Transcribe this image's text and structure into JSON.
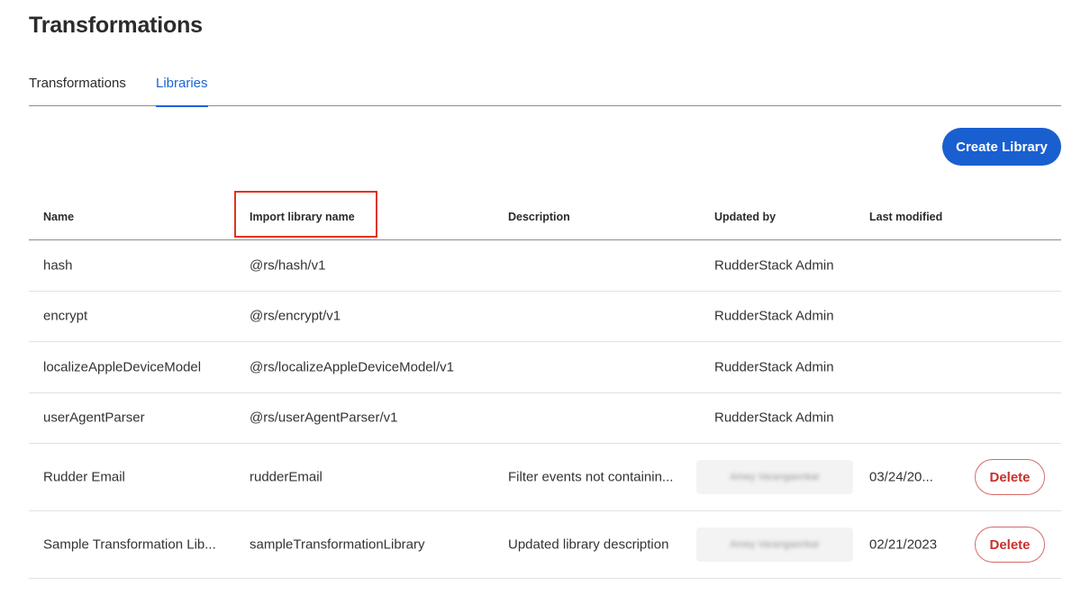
{
  "page": {
    "title": "Transformations"
  },
  "tabs": [
    {
      "label": "Transformations",
      "active": false
    },
    {
      "label": "Libraries",
      "active": true
    }
  ],
  "toolbar": {
    "create_label": "Create Library"
  },
  "colors": {
    "accent": "#1a5fd0",
    "highlight": "#e0341f",
    "danger": "#c9302c"
  },
  "table": {
    "columns": [
      "Name",
      "Import library name",
      "Description",
      "Updated by",
      "Last modified"
    ],
    "rows": [
      {
        "name": "hash",
        "import_name": "@rs/hash/v1",
        "description": "",
        "updated_by": "RudderStack Admin",
        "last_modified": ""
      },
      {
        "name": "encrypt",
        "import_name": "@rs/encrypt/v1",
        "description": "",
        "updated_by": "RudderStack Admin",
        "last_modified": ""
      },
      {
        "name": "localizeAppleDeviceModel",
        "import_name": "@rs/localizeAppleDeviceModel/v1",
        "description": "",
        "updated_by": "RudderStack Admin",
        "last_modified": ""
      },
      {
        "name": "userAgentParser",
        "import_name": "@rs/userAgentParser/v1",
        "description": "",
        "updated_by": "RudderStack Admin",
        "last_modified": ""
      },
      {
        "name": "Rudder Email",
        "import_name": "rudderEmail",
        "description": "Filter events not containin...",
        "updated_by": "Amey Varangaonkar",
        "last_modified": "03/24/20...",
        "action": "Delete"
      },
      {
        "name": "Sample Transformation Lib...",
        "import_name": "sampleTransformationLibrary",
        "description": "Updated library description",
        "updated_by": "Amey Varangaonkar",
        "last_modified": "02/21/2023",
        "action": "Delete"
      }
    ]
  }
}
